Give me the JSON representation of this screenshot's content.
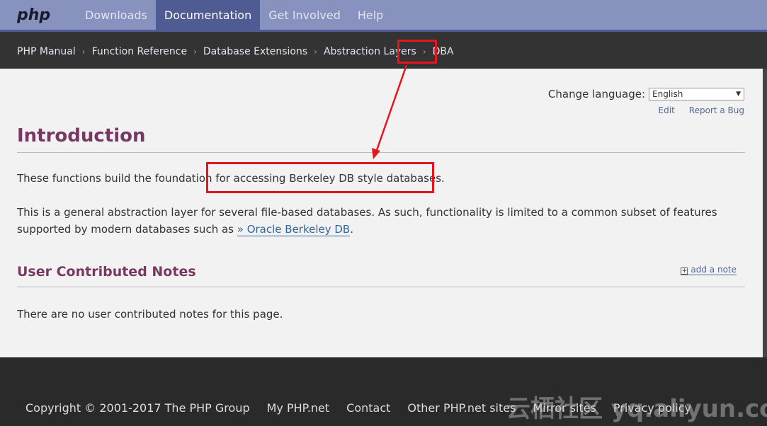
{
  "nav": {
    "logo": "php",
    "items": [
      "Downloads",
      "Documentation",
      "Get Involved",
      "Help"
    ],
    "active": "Documentation"
  },
  "breadcrumb": [
    "PHP Manual",
    "Function Reference",
    "Database Extensions",
    "Abstraction Layers",
    "DBA"
  ],
  "lang": {
    "label": "Change language:",
    "selected": "English"
  },
  "links": {
    "edit": "Edit",
    "bug": "Report a Bug"
  },
  "content": {
    "title": "Introduction",
    "p1": "These functions build the foundation for accessing Berkeley DB style databases.",
    "p2": "This is a general abstraction layer for several file-based databases. As such, functionality is limited to a common subset of features supported by modern databases such as ",
    "p2_link": "» Oracle Berkeley DB",
    "p2_end": "."
  },
  "notes": {
    "title": "User Contributed Notes",
    "add": "add a note",
    "empty": "There are no user contributed notes for this page."
  },
  "footer": [
    "Copyright © 2001-2017 The PHP Group",
    "My PHP.net",
    "Contact",
    "Other PHP.net sites",
    "Mirror sites",
    "Privacy policy"
  ],
  "watermark": "云栖社区 yq.aliyun.com",
  "colors": {
    "annotation": "#e8141b",
    "nav": "#8892bf",
    "heading": "#793862"
  }
}
